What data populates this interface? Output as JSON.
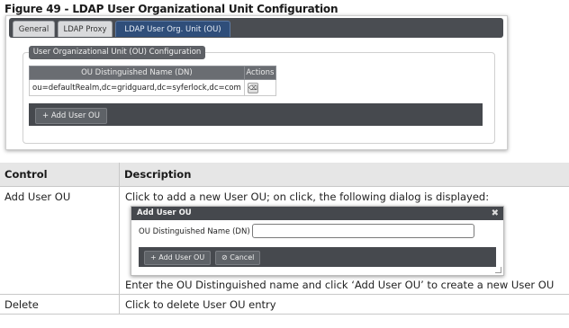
{
  "figure_caption": "Figure 49 - LDAP User Organizational Unit Configuration",
  "tabs": [
    {
      "label": "General",
      "active": false
    },
    {
      "label": "LDAP Proxy",
      "active": false
    },
    {
      "label": "LDAP User Org. Unit (OU)",
      "active": true
    }
  ],
  "ou_section": {
    "title": "User Organizational Unit (OU) Configuration",
    "columns": [
      "OU Distinguished Name (DN)",
      "Actions"
    ],
    "rows": [
      {
        "dn": "ou=defaultRealm,dc=gridguard,dc=syferlock,dc=com",
        "action_icon": "trash-icon"
      }
    ],
    "add_button": "+ Add User OU"
  },
  "desc_table": {
    "headers": [
      "Control",
      "Description"
    ],
    "rows": [
      {
        "control": "Add User OU",
        "description_before": "Click to add a new User OU; on click, the following dialog is displayed:",
        "description_after": "Enter the OU Distinguished name and click ‘Add User OU’ to create a new User OU"
      },
      {
        "control": "Delete",
        "description": "Click to delete User OU entry"
      }
    ]
  },
  "dialog": {
    "title": "Add User OU",
    "close_icon": "✖",
    "field_label": "OU Distinguished Name (DN)",
    "field_value": "",
    "add_button": "+ Add User OU",
    "cancel_button": "⊘ Cancel"
  },
  "colors": {
    "tabbar": "#4a4d52",
    "active_tab": "#2f4e7a",
    "action_bar": "#46494e",
    "table_header": "#e6e6e6"
  }
}
